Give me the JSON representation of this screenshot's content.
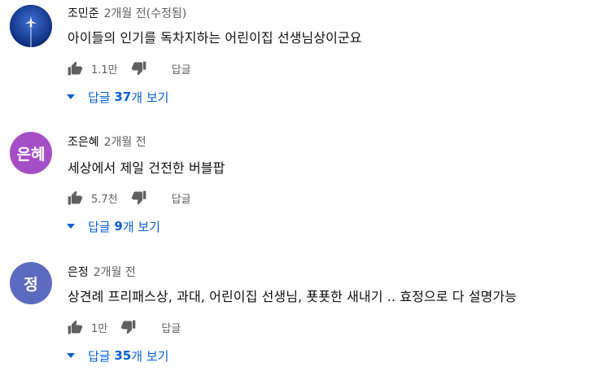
{
  "comments": [
    {
      "author": "조민준",
      "time": "2개월 전(수정됨)",
      "text": "아이들의 인기를 독차지하는 어린이집 선생님상이군요",
      "likes": "1.1만",
      "reply_label": "답글",
      "replies_prefix": "답글 ",
      "replies_count": "37",
      "replies_suffix": "개 보기",
      "avatar_initials": "",
      "avatar_color": "#1a3a8f"
    },
    {
      "author": "조은혜",
      "time": "2개월 전",
      "text": "세상에서 제일 건전한 버블팝",
      "likes": "5.7천",
      "reply_label": "답글",
      "replies_prefix": "답글 ",
      "replies_count": "9",
      "replies_suffix": "개 보기",
      "avatar_initials": "은혜",
      "avatar_color": "#a54fc7"
    },
    {
      "author": "은정",
      "time": "2개월 전",
      "text": "상견례 프리패스상, 과대, 어린이집 선생님, 푯푯한 새내기 .. 효정으로 다 설명가능",
      "likes": "1만",
      "reply_label": "답글",
      "replies_prefix": "답글 ",
      "replies_count": "35",
      "replies_suffix": "개 보기",
      "avatar_initials": "정",
      "avatar_color": "#5c6bc0"
    }
  ]
}
